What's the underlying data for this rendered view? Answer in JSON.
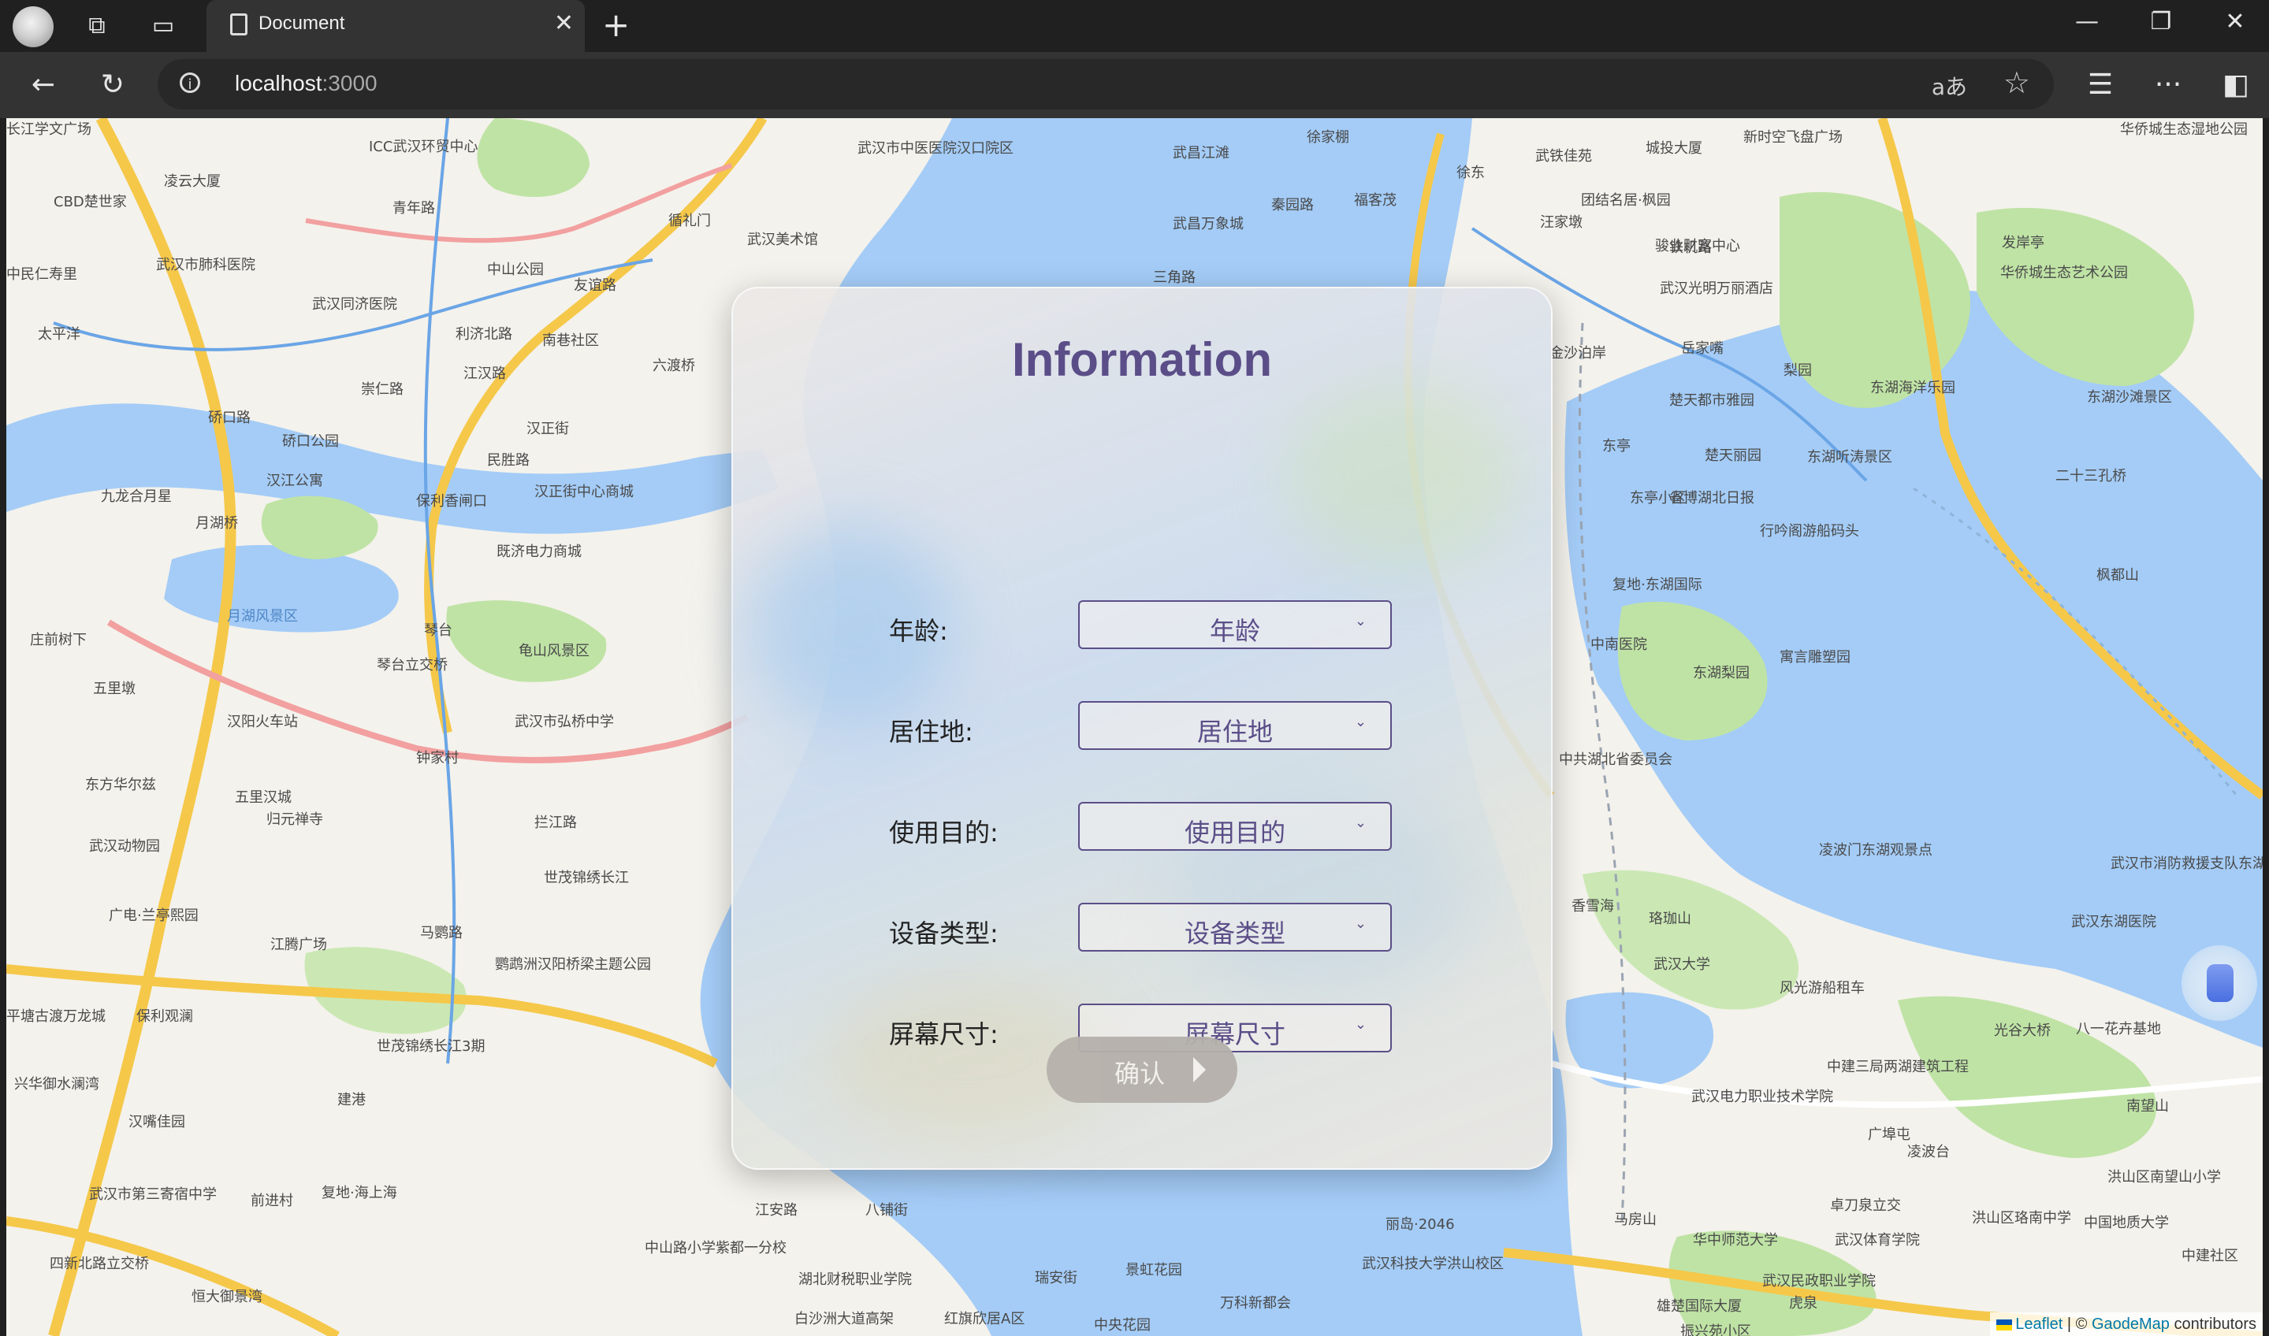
{
  "browser": {
    "tab_title": "Document",
    "url_host": "localhost",
    "url_port": ":3000",
    "new_tab_symbol": "+",
    "read_aloud_symbol": "aあ"
  },
  "form": {
    "title": "Information",
    "fields": [
      {
        "label": "年龄:",
        "placeholder": "年龄"
      },
      {
        "label": "居住地:",
        "placeholder": "居住地"
      },
      {
        "label": "使用目的:",
        "placeholder": "使用目的"
      },
      {
        "label": "设备类型:",
        "placeholder": "设备类型"
      },
      {
        "label": "屏幕尺寸:",
        "placeholder": "屏幕尺寸"
      }
    ],
    "confirm_label": "确认"
  },
  "attribution": {
    "leaflet": "Leaflet",
    "separator": " | © ",
    "gaode": "GaodeMap",
    "contributors": " contributors"
  },
  "map_labels": [
    {
      "text": "CBD楚世家",
      "cls": ""
    },
    {
      "text": "凌云大厦",
      "cls": ""
    },
    {
      "text": "武汉市肺科医院",
      "cls": ""
    },
    {
      "text": "中民仁寿里",
      "cls": ""
    },
    {
      "text": "武汉同济医院",
      "cls": ""
    },
    {
      "text": "太平洋",
      "cls": ""
    },
    {
      "text": "青年路",
      "cls": ""
    },
    {
      "text": "ICC武汉环贸中心",
      "cls": ""
    },
    {
      "text": "中山公园",
      "cls": ""
    },
    {
      "text": "友谊路",
      "cls": ""
    },
    {
      "text": "利济北路",
      "cls": ""
    },
    {
      "text": "南巷社区",
      "cls": ""
    },
    {
      "text": "崇仁路",
      "cls": ""
    },
    {
      "text": "硚口路",
      "cls": ""
    },
    {
      "text": "硚口公园",
      "cls": ""
    },
    {
      "text": "汉正街",
      "cls": ""
    },
    {
      "text": "六渡桥",
      "cls": ""
    },
    {
      "text": "江汉路",
      "cls": ""
    },
    {
      "text": "武汉美术馆",
      "cls": ""
    },
    {
      "text": "循礼门",
      "cls": ""
    },
    {
      "text": "武汉市中医医院汉口院区",
      "cls": ""
    },
    {
      "text": "汉江公寓",
      "cls": ""
    },
    {
      "text": "九龙合月星",
      "cls": ""
    },
    {
      "text": "月湖桥",
      "cls": ""
    },
    {
      "text": "汉正街中心商城",
      "cls": ""
    },
    {
      "text": "既济电力商城",
      "cls": ""
    },
    {
      "text": "民胜路",
      "cls": ""
    },
    {
      "text": "保利香闸口",
      "cls": ""
    },
    {
      "text": "月湖风景区",
      "cls": "water"
    },
    {
      "text": "琴台",
      "cls": ""
    },
    {
      "text": "龟山风景区",
      "cls": ""
    },
    {
      "text": "琴台立交桥",
      "cls": ""
    },
    {
      "text": "五里墩",
      "cls": ""
    },
    {
      "text": "汉阳火车站",
      "cls": ""
    },
    {
      "text": "庄前树下",
      "cls": ""
    },
    {
      "text": "武汉市弘桥中学",
      "cls": ""
    },
    {
      "text": "钟家村",
      "cls": ""
    },
    {
      "text": "五里汉城",
      "cls": ""
    },
    {
      "text": "东方华尔兹",
      "cls": ""
    },
    {
      "text": "归元禅寺",
      "cls": ""
    },
    {
      "text": "武汉动物园",
      "cls": ""
    },
    {
      "text": "广电·兰亭熙园",
      "cls": ""
    },
    {
      "text": "拦江路",
      "cls": ""
    },
    {
      "text": "世茂锦绣长江",
      "cls": ""
    },
    {
      "text": "马鹦路",
      "cls": ""
    },
    {
      "text": "江腾广场",
      "cls": ""
    },
    {
      "text": "鹦鹉洲汉阳桥梁主题公园",
      "cls": ""
    },
    {
      "text": "保利观澜",
      "cls": ""
    },
    {
      "text": "平塘古渡万龙城",
      "cls": ""
    },
    {
      "text": "兴华御水澜湾",
      "cls": ""
    },
    {
      "text": "世茂锦绣长江3期",
      "cls": ""
    },
    {
      "text": "建港",
      "cls": ""
    },
    {
      "text": "汉嘴佳园",
      "cls": ""
    },
    {
      "text": "武汉市第三寄宿中学",
      "cls": ""
    },
    {
      "text": "前进村",
      "cls": ""
    },
    {
      "text": "复地·海上海",
      "cls": ""
    },
    {
      "text": "四新北路立交桥",
      "cls": ""
    },
    {
      "text": "恒大御景湾",
      "cls": ""
    },
    {
      "text": "中山路小学紫都一分校",
      "cls": ""
    },
    {
      "text": "江安路",
      "cls": ""
    },
    {
      "text": "湖北财税职业学院",
      "cls": ""
    },
    {
      "text": "白沙洲大道高架",
      "cls": ""
    },
    {
      "text": "红旗欣居A区",
      "cls": ""
    },
    {
      "text": "八铺街",
      "cls": ""
    },
    {
      "text": "瑞安街",
      "cls": ""
    },
    {
      "text": "景虹花园",
      "cls": ""
    },
    {
      "text": "万科新都会",
      "cls": ""
    },
    {
      "text": "中央花园",
      "cls": ""
    },
    {
      "text": "武昌江滩",
      "cls": ""
    },
    {
      "text": "武昌万象城",
      "cls": ""
    },
    {
      "text": "三角路",
      "cls": ""
    },
    {
      "text": "秦园路",
      "cls": ""
    },
    {
      "text": "福客茂",
      "cls": ""
    },
    {
      "text": "徐家棚",
      "cls": ""
    },
    {
      "text": "徐东",
      "cls": ""
    },
    {
      "text": "武铁佳苑",
      "cls": ""
    },
    {
      "text": "城投大厦",
      "cls": ""
    },
    {
      "text": "团结名居·枫园",
      "cls": ""
    },
    {
      "text": "汪家墩",
      "cls": ""
    },
    {
      "text": "骏业财富中心",
      "cls": ""
    },
    {
      "text": "铁机路",
      "cls": ""
    },
    {
      "text": "武汉光明万丽酒店",
      "cls": ""
    },
    {
      "text": "金沙泊岸",
      "cls": ""
    },
    {
      "text": "岳家嘴",
      "cls": ""
    },
    {
      "text": "梨园",
      "cls": ""
    },
    {
      "text": "楚天都市雅园",
      "cls": ""
    },
    {
      "text": "楚天丽园",
      "cls": ""
    },
    {
      "text": "东亭",
      "cls": ""
    },
    {
      "text": "东亭小区",
      "cls": ""
    },
    {
      "text": "省博湖北日报",
      "cls": ""
    },
    {
      "text": "复地·东湖国际",
      "cls": ""
    },
    {
      "text": "中南医院",
      "cls": ""
    },
    {
      "text": "东湖海洋乐园",
      "cls": ""
    },
    {
      "text": "东湖听涛景区",
      "cls": ""
    },
    {
      "text": "行吟阁游船码头",
      "cls": ""
    },
    {
      "text": "东湖梨园",
      "cls": ""
    },
    {
      "text": "寓言雕塑园",
      "cls": ""
    },
    {
      "text": "中共湖北省委员会",
      "cls": ""
    },
    {
      "text": "凌波门东湖观景点",
      "cls": ""
    },
    {
      "text": "珞珈山",
      "cls": ""
    },
    {
      "text": "武汉大学",
      "cls": ""
    },
    {
      "text": "风光游船租车",
      "cls": ""
    },
    {
      "text": "光谷大桥",
      "cls": ""
    },
    {
      "text": "八一花卉基地",
      "cls": ""
    },
    {
      "text": "中建三局两湖建筑工程",
      "cls": ""
    },
    {
      "text": "武汉电力职业技术学院",
      "cls": ""
    },
    {
      "text": "广埠屯",
      "cls": ""
    },
    {
      "text": "凌波台",
      "cls": ""
    },
    {
      "text": "卓刀泉立交",
      "cls": ""
    },
    {
      "text": "华中师范大学",
      "cls": ""
    },
    {
      "text": "武汉体育学院",
      "cls": ""
    },
    {
      "text": "武汉科技大学洪山校区",
      "cls": ""
    },
    {
      "text": "马房山",
      "cls": ""
    },
    {
      "text": "武汉民政职业学院",
      "cls": ""
    },
    {
      "text": "虎泉",
      "cls": ""
    },
    {
      "text": "丽岛·2046",
      "cls": ""
    },
    {
      "text": "雄楚国际大厦",
      "cls": ""
    },
    {
      "text": "洪山区珞南中学",
      "cls": ""
    },
    {
      "text": "中国地质大学",
      "cls": ""
    },
    {
      "text": "洪山区南望山小学",
      "cls": ""
    },
    {
      "text": "中建社区",
      "cls": ""
    },
    {
      "text": "南望山",
      "cls": ""
    },
    {
      "text": "武汉东湖医院",
      "cls": ""
    },
    {
      "text": "枫都山",
      "cls": ""
    },
    {
      "text": "二十三孔桥",
      "cls": ""
    },
    {
      "text": "东湖沙滩景区",
      "cls": ""
    },
    {
      "text": "发岸亭",
      "cls": ""
    },
    {
      "text": "华侨城生态艺术公园",
      "cls": ""
    },
    {
      "text": "华侨城生态湿地公园",
      "cls": ""
    },
    {
      "text": "新时空飞盘广场",
      "cls": ""
    },
    {
      "text": "武汉市消防救援支队东湖景区大队华侨城消防救援站",
      "cls": ""
    },
    {
      "text": "香雪海",
      "cls": ""
    },
    {
      "text": "振兴苑小区",
      "cls": ""
    },
    {
      "text": "长江学文广场",
      "cls": ""
    }
  ]
}
